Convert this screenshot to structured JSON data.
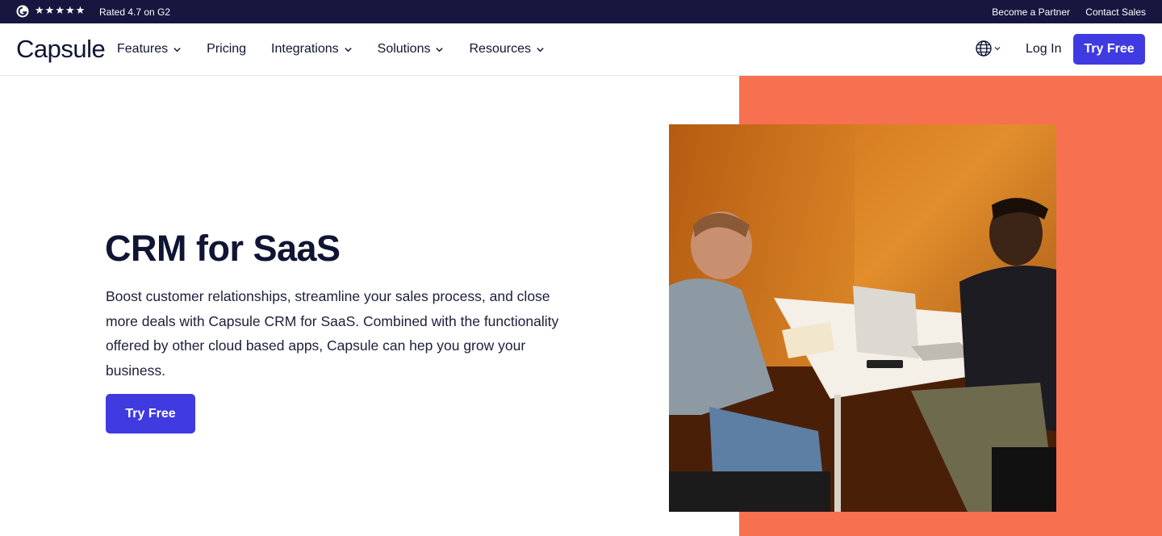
{
  "topbar": {
    "rating_text": "Rated 4.7 on G2",
    "stars": [
      "★",
      "★",
      "★",
      "★",
      "★"
    ],
    "become_partner": "Become a Partner",
    "contact_sales": "Contact Sales"
  },
  "nav": {
    "logo": "Capsule",
    "items": [
      {
        "label": "Features",
        "has_dropdown": true
      },
      {
        "label": "Pricing",
        "has_dropdown": false
      },
      {
        "label": "Integrations",
        "has_dropdown": true
      },
      {
        "label": "Solutions",
        "has_dropdown": true
      },
      {
        "label": "Resources",
        "has_dropdown": true
      }
    ],
    "login": "Log In",
    "try_free": "Try Free"
  },
  "hero": {
    "title": "CRM for SaaS",
    "description": "Boost customer relationships, streamline your sales process, and close more deals with Capsule CRM for SaaS. Combined with the functionality offered by other cloud based apps, Capsule can hep you grow your business.",
    "cta": "Try Free"
  },
  "colors": {
    "topbar_bg": "#16163f",
    "accent": "#3f3be0",
    "coral": "#f7704f",
    "text_dark": "#0f1533"
  }
}
